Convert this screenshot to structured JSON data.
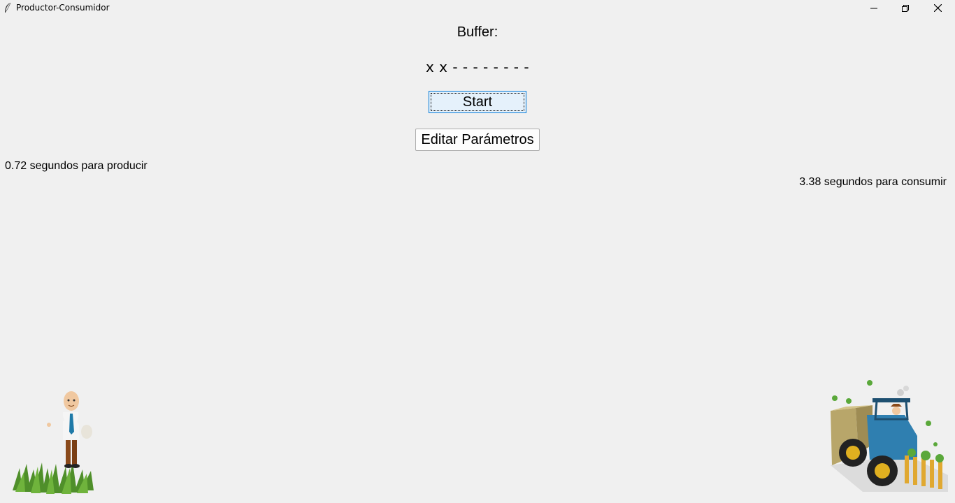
{
  "window": {
    "title": "Productor-Consumidor",
    "icons": {
      "app": "feather-icon",
      "minimize": "minimize-icon",
      "maximize": "restore-icon",
      "close": "close-icon"
    }
  },
  "buffer": {
    "label": "Buffer:",
    "value": "x x - - - - - - - -"
  },
  "controls": {
    "start_label": "Start",
    "edit_label": "Editar Parámetros"
  },
  "producer": {
    "time_text": "0.72 segundos para producir",
    "image": "farmer-sowing-image"
  },
  "consumer": {
    "time_text": "3.38 segundos para consumir",
    "image": "tractor-harvesting-image"
  },
  "colors": {
    "background": "#f0f0f0",
    "start_button_bg": "#e5f1fb",
    "start_button_border": "#0078d7"
  }
}
